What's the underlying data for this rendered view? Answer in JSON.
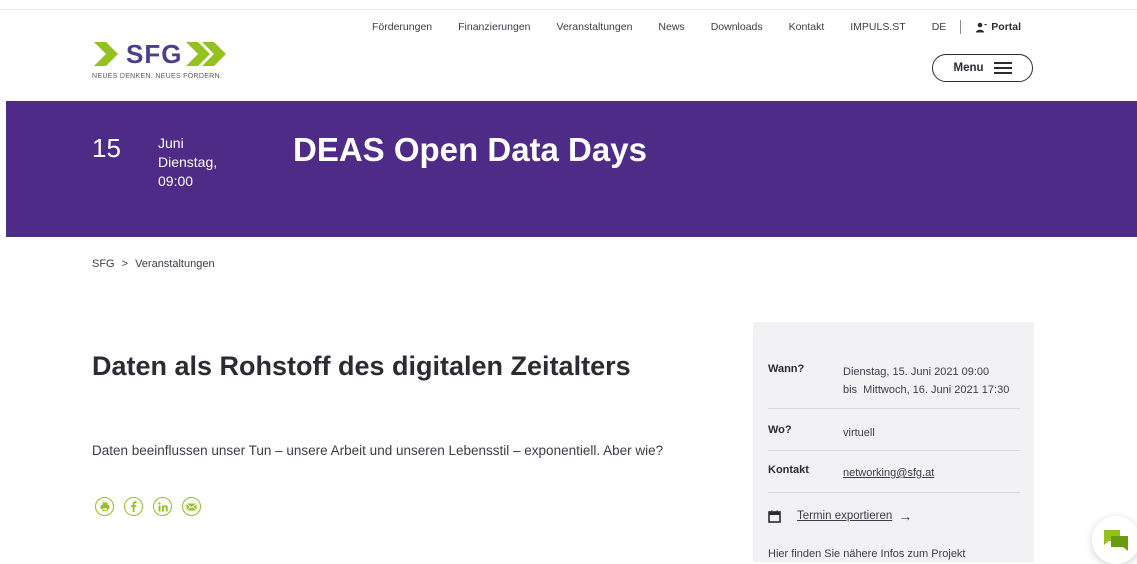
{
  "brand": {
    "name": "SFG",
    "tagline": "NEUES DENKEN. NEUES FÖRDERN.",
    "color_primary": "#4d2b86",
    "color_accent": "#93c11f"
  },
  "topnav": {
    "items": [
      "Förderungen",
      "Finanzierungen",
      "Veranstaltungen",
      "News",
      "Downloads",
      "Kontakt",
      "IMPULS.ST"
    ],
    "language": "DE",
    "portal": "Portal"
  },
  "menu": {
    "label": "Menu",
    "icon": "hamburger-icon"
  },
  "hero": {
    "day": "15",
    "month": "Juni",
    "weekday": "Dienstag,",
    "time": "09:00",
    "title": "DEAS Open Data Days"
  },
  "breadcrumb": {
    "home": "SFG",
    "separator": ">",
    "current": "Veranstaltungen"
  },
  "article": {
    "headline": "Daten als Rohstoff des digitalen Zeitalters",
    "lead": "Daten beeinflussen unser Tun – unsere Arbeit und unseren Lebensstil – exponentiell. Aber wie?",
    "share_icons": [
      "print-icon",
      "facebook-icon",
      "linkedin-icon",
      "email-icon"
    ]
  },
  "info": {
    "when_label": "Wann?",
    "when_line1": "Dienstag, 15. Juni 2021 09:00",
    "when_line2": "bis  Mittwoch, 16. Juni 2021 17:30",
    "where_label": "Wo?",
    "where_value": "virtuell",
    "contact_label": "Kontakt",
    "contact_value": "networking@sfg.at",
    "export_label": "Termin exportieren",
    "more_text": "Hier finden Sie nähere Infos zum Projekt"
  },
  "chat": {
    "icon": "chat-icon"
  }
}
